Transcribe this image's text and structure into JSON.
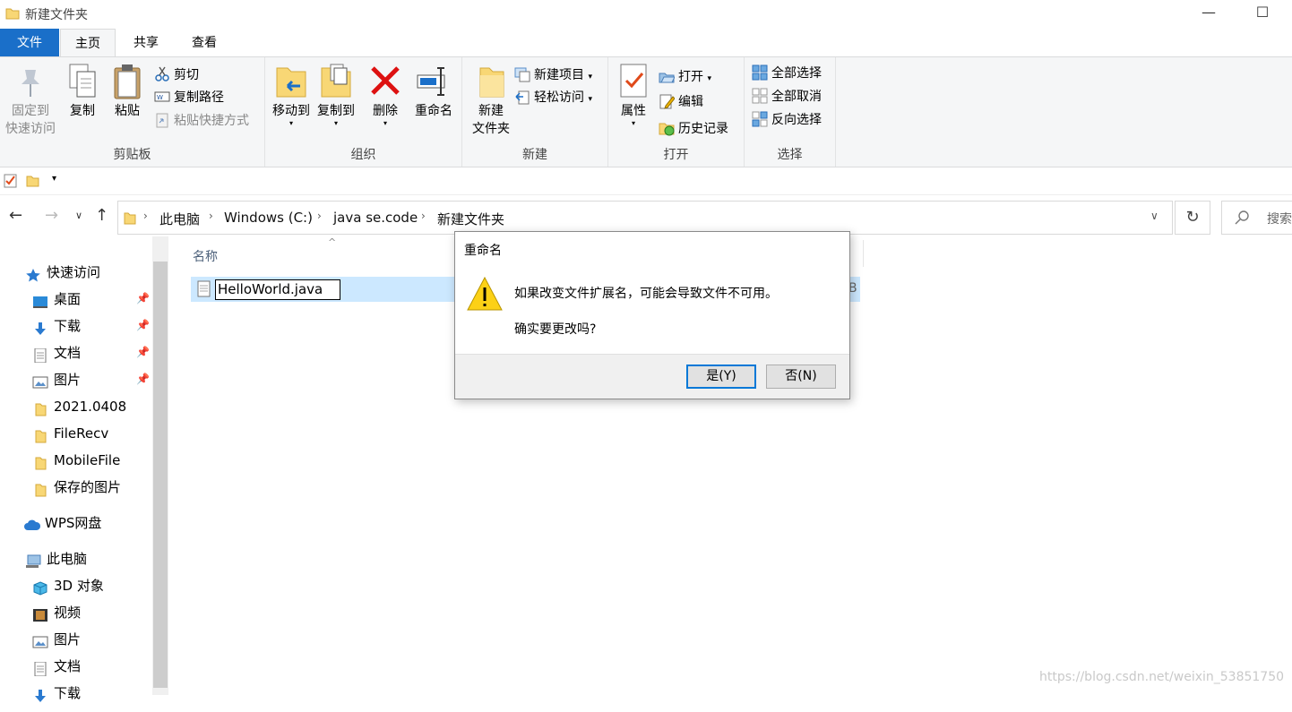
{
  "window": {
    "title": "新建文件夹",
    "minimize": "—",
    "maximize": "☐"
  },
  "tabs": [
    {
      "label": "文件"
    },
    {
      "label": "主页"
    },
    {
      "label": "共享"
    },
    {
      "label": "查看"
    }
  ],
  "ribbon": {
    "clipboard": {
      "name": "剪贴板",
      "pin_line1": "固定到",
      "pin_line2": "快速访问",
      "copy": "复制",
      "paste": "粘贴",
      "cut": "剪切",
      "copy_path": "复制路径",
      "paste_shortcut": "粘贴快捷方式"
    },
    "organize": {
      "name": "组织",
      "move_to": "移动到",
      "copy_to": "复制到",
      "delete": "删除",
      "rename": "重命名"
    },
    "new": {
      "name": "新建",
      "new_folder_line1": "新建",
      "new_folder_line2": "文件夹",
      "new_item": "新建项目",
      "easy_access": "轻松访问"
    },
    "open": {
      "name": "打开",
      "properties": "属性",
      "open": "打开",
      "edit": "编辑",
      "history": "历史记录"
    },
    "select": {
      "name": "选择",
      "select_all": "全部选择",
      "select_none": "全部取消",
      "invert": "反向选择"
    }
  },
  "address": {
    "crumbs": [
      "此电脑",
      "Windows (C:)",
      "java se.code",
      "新建文件夹"
    ],
    "search_placeholder": "搜索"
  },
  "nav": {
    "quick_access": "快速访问",
    "pinned": [
      "桌面",
      "下载",
      "文档",
      "图片"
    ],
    "folders": [
      "2021.0408",
      "FileRecv",
      "MobileFile",
      "保存的图片"
    ],
    "wps": "WPS网盘",
    "this_pc": "此电脑",
    "pc_items": [
      "3D 对象",
      "视频",
      "图片",
      "文档",
      "下载"
    ]
  },
  "content": {
    "column_name": "名称",
    "file_rename_value": "HelloWorld.java",
    "size_fragment": "B"
  },
  "dialog": {
    "title": "重命名",
    "message": "如果改变文件扩展名，可能会导致文件不可用。",
    "question": "确实要更改吗?",
    "yes": "是(Y)",
    "no": "否(N)"
  },
  "watermark": "https://blog.csdn.net/weixin_53851750",
  "colors": {
    "accent": "#1a6fc9",
    "selection": "#cce8ff",
    "folder": "#f8d775"
  }
}
